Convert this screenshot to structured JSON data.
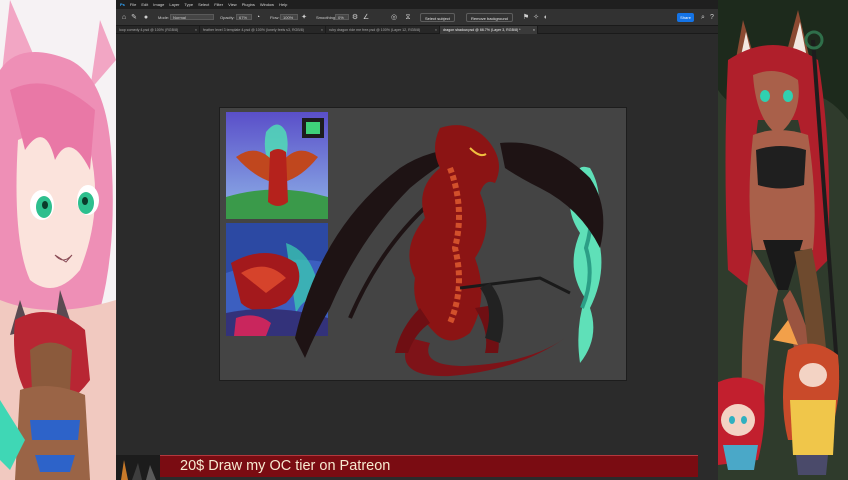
{
  "menu": [
    "Ps",
    "File",
    "Edit",
    "Image",
    "Layer",
    "Type",
    "Select",
    "Filter",
    "View",
    "Plugins",
    "Window",
    "Help"
  ],
  "options_bar": {
    "mode_label": "Mode:",
    "mode_value": "Normal",
    "opacity_label": "Opacity:",
    "opacity_value": "67%",
    "flow_label": "Flow:",
    "flow_value": "100%",
    "smoothing_label": "Smoothing:",
    "smoothing_value": "0%",
    "select_subject": "Select subject",
    "remove_background": "Remove background",
    "share": "Share"
  },
  "tabs": [
    {
      "label": "loop comedy 4.psd @ 100% (RGB/8)",
      "active": false
    },
    {
      "label": "feather level 3 template 4.psd @ 100% (lonely feels s3, RGB/8)",
      "active": false
    },
    {
      "label": "ruby dragon ride me free.psd @ 100% (Layer 12, RGB/8)",
      "active": false
    },
    {
      "label": "dragon shadow.psd @ 66.7% (Layer 3, RGB/8) *",
      "active": true
    }
  ],
  "banner": {
    "text": "20$ Draw my OC tier on Patreon"
  },
  "colors": {
    "banner_bg": "#7a0c12",
    "share_blue": "#1473e6",
    "canvas_gray": "#444444",
    "dragon_red": "#8b1414",
    "flame_cyan": "#5fe0b8"
  }
}
